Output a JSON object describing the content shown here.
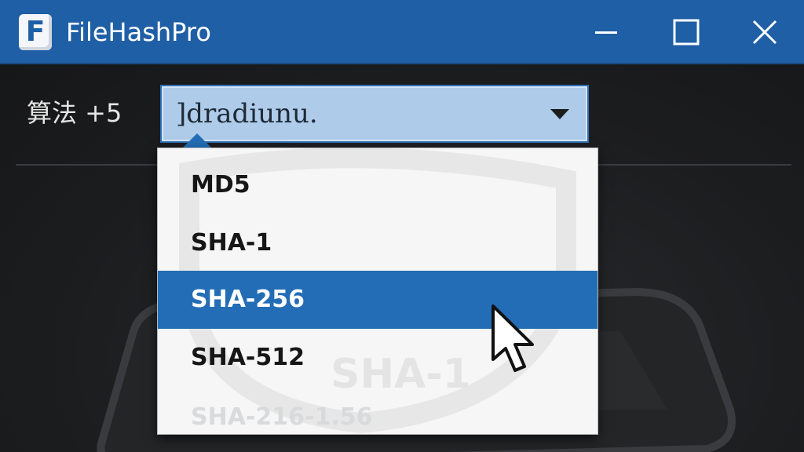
{
  "window": {
    "title": "FileHashPro",
    "icon_letter": "F",
    "controls": [
      "minimize",
      "maximize",
      "close"
    ],
    "titlebar_color": "#1f5fa6"
  },
  "algorithm": {
    "label": "算法 +5",
    "selected_value": "]dradiunu.",
    "dropdown_icon": "chevron-down-icon"
  },
  "dropdown": {
    "options": [
      {
        "label": "MD5"
      },
      {
        "label": "SHA-1"
      },
      {
        "label": "SHA-256",
        "highlighted": true
      },
      {
        "label": "SHA-512"
      },
      {
        "label": "SHA-216-1.56",
        "faded": true
      }
    ],
    "highlight_color": "#226db5"
  },
  "background": {
    "watermark_texts": [
      "SHA-1",
      "SHA-1"
    ]
  }
}
